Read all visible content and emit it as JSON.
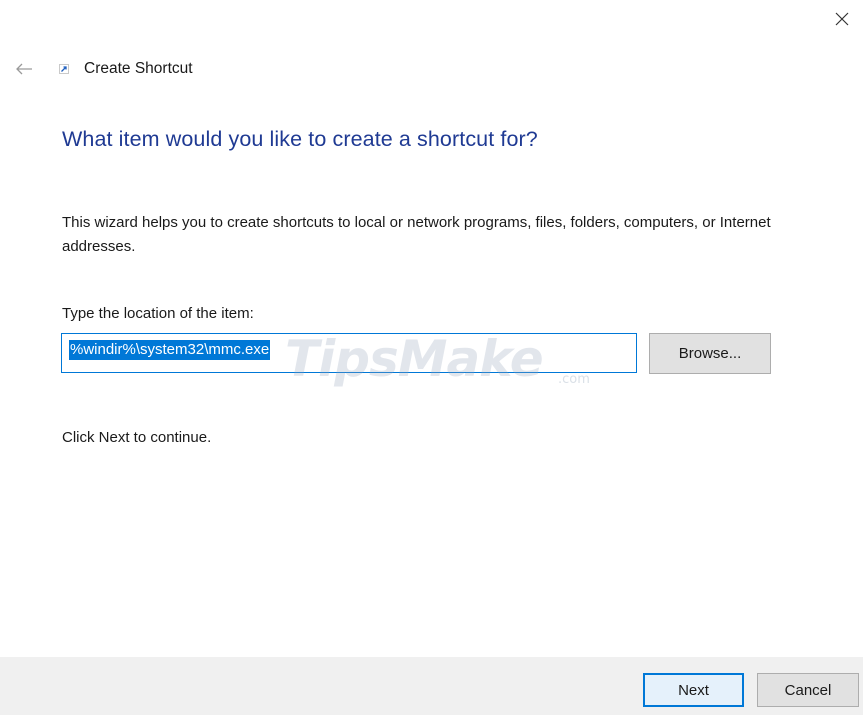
{
  "window": {
    "title": "Create Shortcut",
    "close_icon": "close-icon",
    "back_icon": "back-arrow-icon",
    "app_icon": "shortcut-icon"
  },
  "wizard": {
    "heading": "What item would you like to create a shortcut for?",
    "description": "This wizard helps you to create shortcuts to local or network programs, files, folders, computers, or Internet addresses.",
    "location_label": "Type the location of the item:",
    "location_value": "%windir%\\system32\\mmc.exe",
    "browse_label": "Browse...",
    "continue_hint": "Click Next to continue."
  },
  "watermark": {
    "text": "TipsMake",
    "suffix": ".com"
  },
  "footer": {
    "next_label": "Next",
    "cancel_label": "Cancel"
  },
  "colors": {
    "heading": "#1f3a93",
    "accent": "#0078d7",
    "footer_bg": "#f0f0f0"
  }
}
